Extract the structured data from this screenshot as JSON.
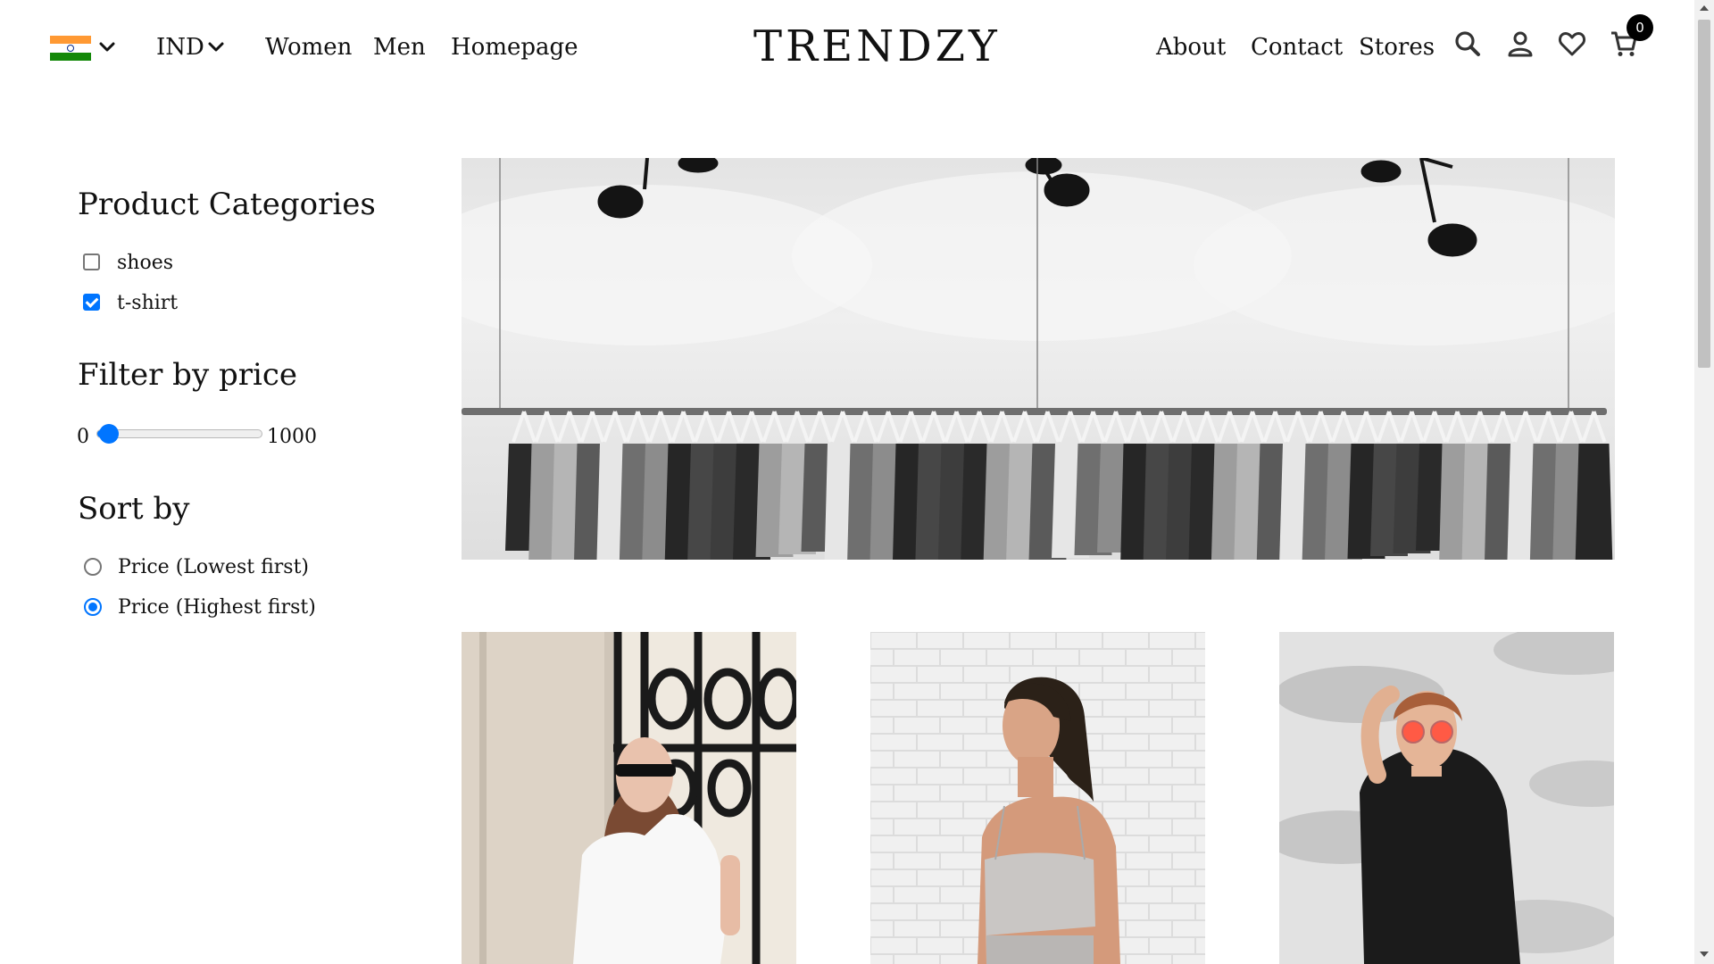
{
  "header": {
    "country_flag": "india-flag",
    "flag_colors": [
      "#ff9933",
      "#ffffff",
      "#138808"
    ],
    "currency": "IND",
    "nav_left": [
      "Women",
      "Men",
      "Homepage"
    ],
    "brand": "TRENDZY",
    "nav_right": [
      "About",
      "Contact",
      "Stores"
    ],
    "icons": [
      "search-icon",
      "user-icon",
      "heart-icon",
      "cart-icon"
    ],
    "cart_count": "0"
  },
  "sidebar": {
    "categories_title": "Product Categories",
    "categories": [
      {
        "label": "shoes",
        "checked": false
      },
      {
        "label": "t-shirt",
        "checked": true
      }
    ],
    "price_title": "Filter by price",
    "price_min": "0",
    "price_max": "1000",
    "price_value_fraction": 0.02,
    "sort_title": "Sort by",
    "sort_options": [
      {
        "label": "Price (Lowest first)",
        "selected": false
      },
      {
        "label": "Price (Highest first)",
        "selected": true
      }
    ]
  },
  "accent_color": "#0075ff"
}
